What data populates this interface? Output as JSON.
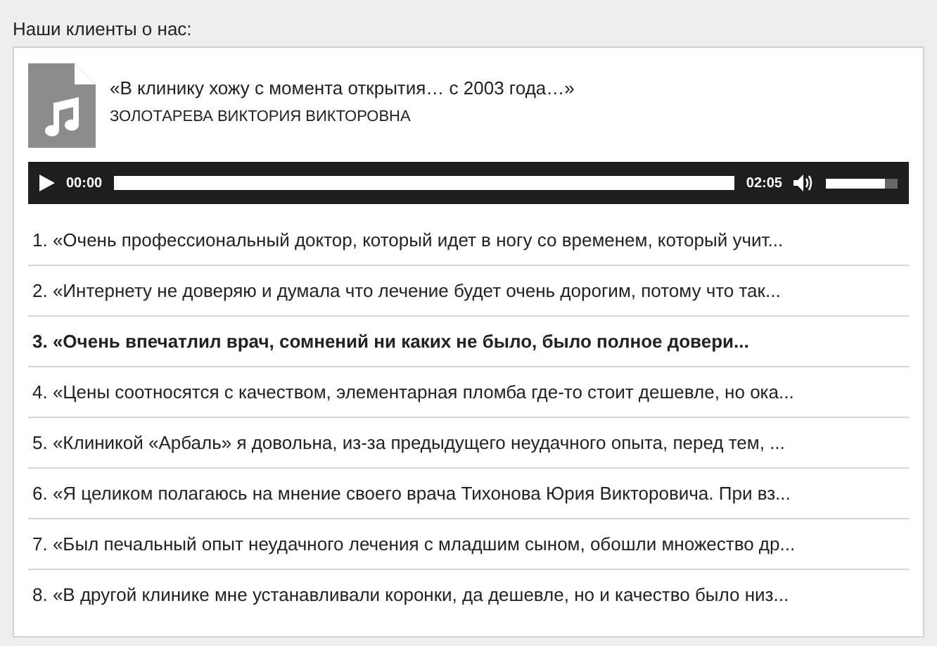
{
  "heading": "Наши клиенты о нас:",
  "track": {
    "title": "«В клинику хожу с момента открытия… с 2003 года…»",
    "author": "ЗОЛОТАРЕВА ВИКТОРИЯ ВИКТОРОВНА"
  },
  "player": {
    "current_time": "00:00",
    "duration": "02:05",
    "volume": {
      "level": 0.83
    }
  },
  "reviews": [
    {
      "text": "1. «Очень профессиональный доктор, который идет в ногу со временем, который учит...",
      "selected": false
    },
    {
      "text": "2. «Интернету не доверяю и думала что лечение будет очень дорогим, потому что так...",
      "selected": false
    },
    {
      "text": "3. «Очень впечатлил врач, сомнений ни каких не было, было полное довери...",
      "selected": true
    },
    {
      "text": "4. «Цены соотносятся с качеством, элементарная пломба где-то стоит дешевле, но ока...",
      "selected": false
    },
    {
      "text": "5. «Клиникой «Арбаль» я довольна, из-за предыдущего неудачного опыта, перед тем, ...",
      "selected": false
    },
    {
      "text": "6. «Я целиком полагаюсь на мнение своего врача Тихонова Юрия Викторовича. При вз...",
      "selected": false
    },
    {
      "text": "7. «Был печальный опыт неудачного лечения с младшим сыном, обошли множество др...",
      "selected": false
    },
    {
      "text": "8. «В другой клинике мне устанавливали коронки, да дешевле, но и качество было низ...",
      "selected": false
    }
  ]
}
